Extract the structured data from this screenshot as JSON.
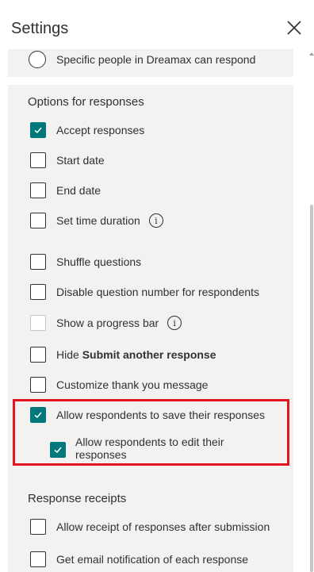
{
  "header": {
    "title": "Settings",
    "close_icon": "close-icon"
  },
  "who_can_respond": {
    "option_label": "Specific people in Dreamax can respond",
    "selected": false
  },
  "options": {
    "heading": "Options for responses",
    "items": [
      {
        "label": "Accept responses",
        "checked": true
      },
      {
        "label": "Start date",
        "checked": false
      },
      {
        "label": "End date",
        "checked": false
      },
      {
        "label": "Set time duration",
        "checked": false,
        "info": true
      },
      {
        "label": "Shuffle questions",
        "checked": false
      },
      {
        "label": "Disable question number for respondents",
        "checked": false
      },
      {
        "label": "Show a progress bar",
        "checked": false,
        "disabled": true,
        "info": true
      },
      {
        "label_prefix": "Hide ",
        "label_bold": "Submit another response",
        "checked": false
      },
      {
        "label": "Customize thank you message",
        "checked": false
      },
      {
        "label": "Allow respondents to save their responses",
        "checked": true
      },
      {
        "label": "Allow respondents to edit their responses",
        "checked": true
      }
    ]
  },
  "receipts": {
    "heading": "Response receipts",
    "items": [
      {
        "label": "Allow receipt of responses after submission",
        "checked": false
      },
      {
        "label": "Get email notification of each response",
        "checked": false
      }
    ]
  },
  "info_glyph": "i",
  "colors": {
    "accent": "#03787c",
    "highlight": "#e3141f",
    "card": "#f3f2f1"
  }
}
